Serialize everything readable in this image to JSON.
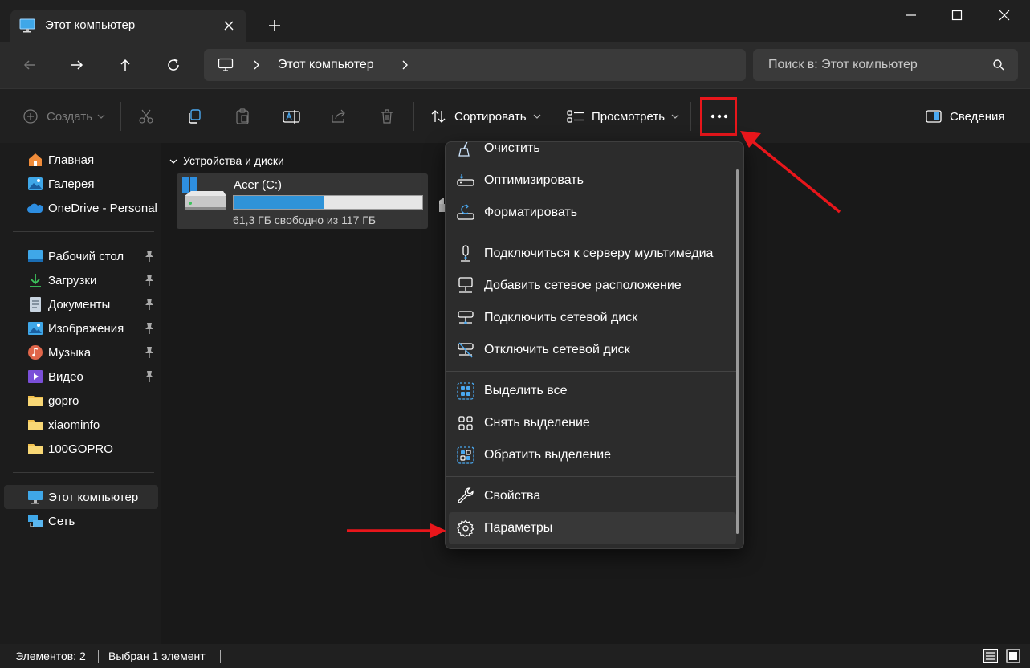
{
  "tab": {
    "title": "Этот компьютер",
    "icon": "this-pc-icon"
  },
  "address": {
    "location": "Этот компьютер"
  },
  "search": {
    "placeholder": "Поиск в: Этот компьютер"
  },
  "toolbar": {
    "create_label": "Создать",
    "sort_label": "Сортировать",
    "view_label": "Просмотреть",
    "details_label": "Сведения",
    "more_icon": "more-options-icon"
  },
  "sidebar": {
    "top": [
      {
        "label": "Главная",
        "icon": "home-icon"
      },
      {
        "label": "Галерея",
        "icon": "gallery-icon"
      },
      {
        "label": "OneDrive - Personal",
        "icon": "onedrive-icon"
      }
    ],
    "pinned": [
      {
        "label": "Рабочий стол",
        "icon": "desktop-icon",
        "pinned": true
      },
      {
        "label": "Загрузки",
        "icon": "downloads-icon",
        "pinned": true
      },
      {
        "label": "Документы",
        "icon": "documents-icon",
        "pinned": true
      },
      {
        "label": "Изображения",
        "icon": "pictures-icon",
        "pinned": true
      },
      {
        "label": "Музыка",
        "icon": "music-icon",
        "pinned": true
      },
      {
        "label": "Видео",
        "icon": "video-icon",
        "pinned": true
      },
      {
        "label": "gopro",
        "icon": "folder-icon",
        "pinned": false
      },
      {
        "label": "xiaominfo",
        "icon": "folder-icon",
        "pinned": false
      },
      {
        "label": "100GOPRO",
        "icon": "folder-icon",
        "pinned": false
      }
    ],
    "bottom": [
      {
        "label": "Этот компьютер",
        "icon": "this-pc-icon",
        "selected": true
      },
      {
        "label": "Сеть",
        "icon": "network-icon"
      }
    ]
  },
  "content": {
    "group_title": "Устройства и диски",
    "drive": {
      "name": "Acer (C:)",
      "free_text": "61,3 ГБ свободно из 117 ГБ",
      "used_fraction": 0.48
    }
  },
  "menu": {
    "items": [
      {
        "label": "Очистить",
        "icon": "broom-icon"
      },
      {
        "label": "Оптимизировать",
        "icon": "optimize-drive-icon"
      },
      {
        "label": "Форматировать",
        "icon": "format-drive-icon"
      },
      {
        "label": "Подключиться к серверу мультимедиа",
        "icon": "media-server-icon"
      },
      {
        "label": "Добавить сетевое расположение",
        "icon": "network-location-icon"
      },
      {
        "label": "Подключить сетевой диск",
        "icon": "map-network-drive-icon"
      },
      {
        "label": "Отключить сетевой диск",
        "icon": "disconnect-network-drive-icon"
      },
      {
        "label": "Выделить все",
        "icon": "select-all-icon"
      },
      {
        "label": "Снять выделение",
        "icon": "select-none-icon"
      },
      {
        "label": "Обратить выделение",
        "icon": "invert-selection-icon"
      },
      {
        "label": "Свойства",
        "icon": "wrench-icon"
      },
      {
        "label": "Параметры",
        "icon": "gear-icon",
        "hovered": true
      }
    ]
  },
  "status": {
    "count": "Элементов: 2",
    "selection": "Выбран 1 элемент"
  },
  "colors": {
    "accent": "#2f93d8",
    "annotation": "#e8161b",
    "background": "#191919"
  }
}
